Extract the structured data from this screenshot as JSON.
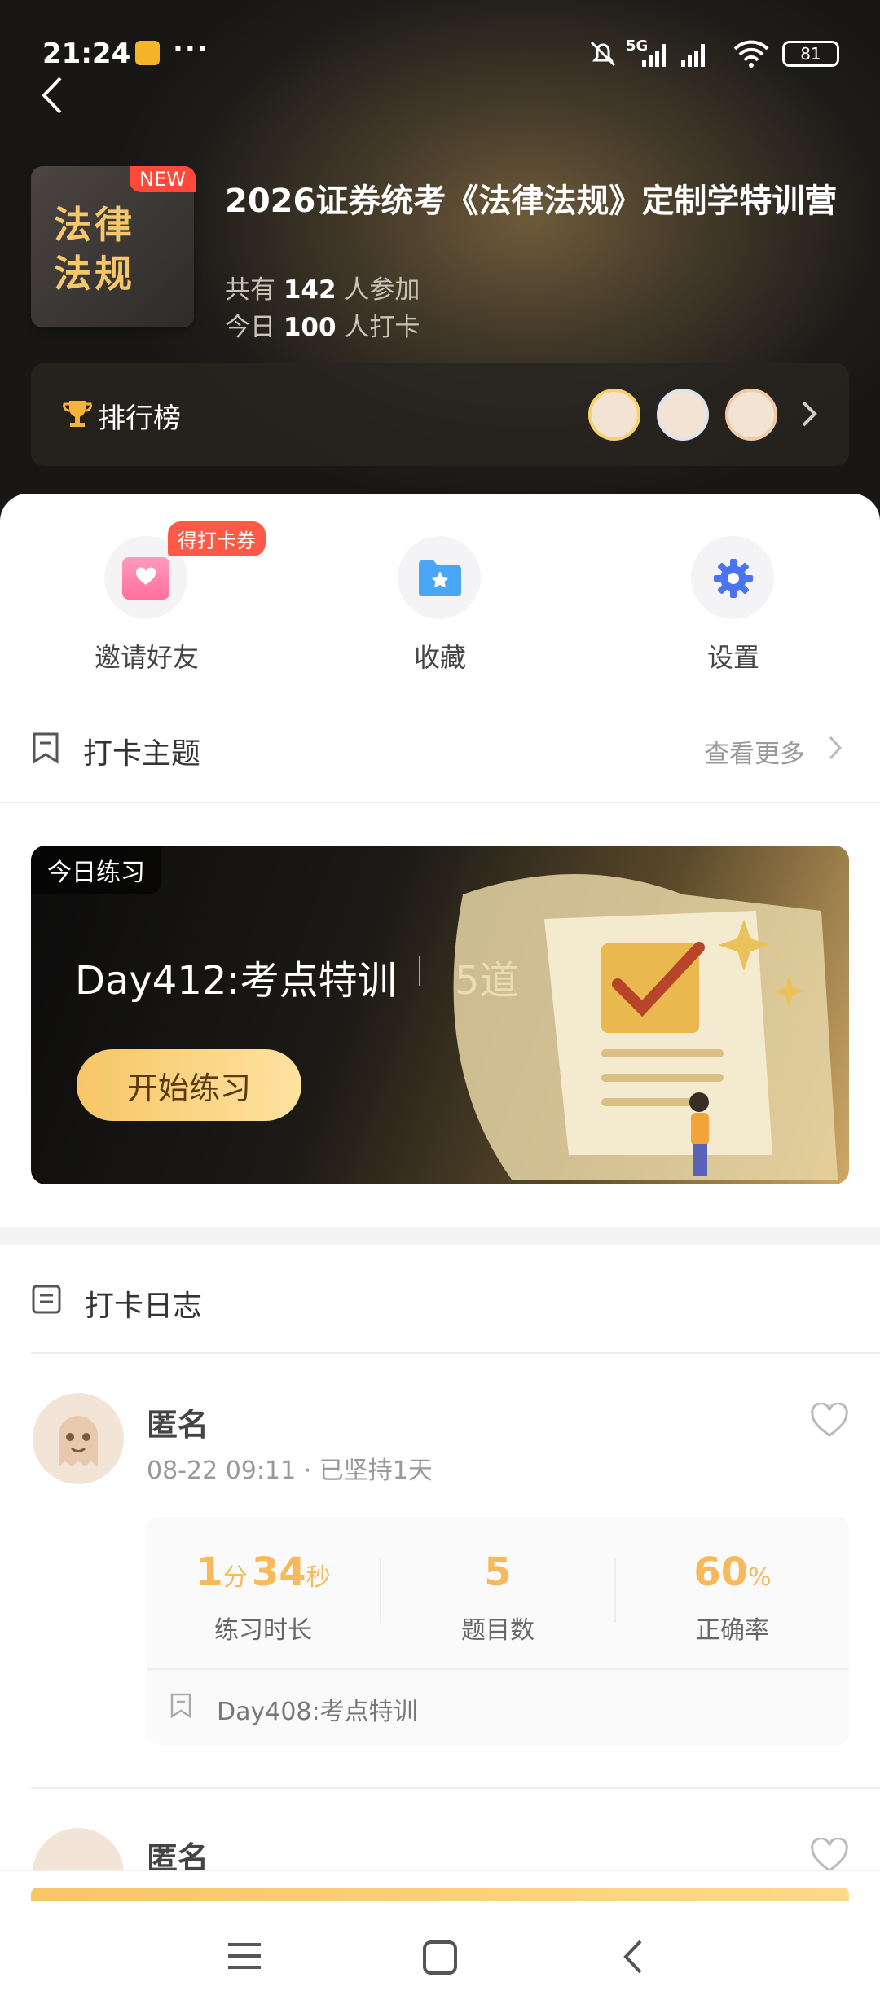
{
  "status_bar": {
    "time": "21:24",
    "battery": "81",
    "network": "5G"
  },
  "course": {
    "cover_text_line1": "法律",
    "cover_text_line2": "法规",
    "new_tag": "NEW",
    "title": "2026证券统考《法律法规》定制学特训营",
    "participants_prefix": "共有",
    "participants_count": "142",
    "participants_suffix": "人参加",
    "checkins_prefix": "今日",
    "checkins_count": "100",
    "checkins_suffix": "人打卡"
  },
  "ranking": {
    "label": "排行榜"
  },
  "quick_actions": [
    {
      "label": "邀请好友",
      "badge": "得打卡券"
    },
    {
      "label": "收藏"
    },
    {
      "label": "设置"
    }
  ],
  "theme_section": {
    "title": "打卡主题",
    "more": "查看更多"
  },
  "banner": {
    "tag": "今日练习",
    "title": "Day412:考点特训",
    "count": "5道",
    "button": "开始练习"
  },
  "log_section": {
    "title": "打卡日志"
  },
  "entries": [
    {
      "name": "匿名",
      "time": "08-22 09:11",
      "streak": "已坚持1天",
      "duration_min": "1",
      "duration_min_unit": "分",
      "duration_sec": "34",
      "duration_sec_unit": "秒",
      "duration_label": "练习时长",
      "questions": "5",
      "questions_label": "题目数",
      "accuracy": "60",
      "accuracy_unit": "%",
      "accuracy_label": "正确率",
      "topic": "Day408:考点特训"
    },
    {
      "name": "匿名"
    }
  ],
  "colors": {
    "accent": "#f6b95b",
    "badge": "#ff4a3a",
    "hero_bg": "#1f1d1a"
  }
}
